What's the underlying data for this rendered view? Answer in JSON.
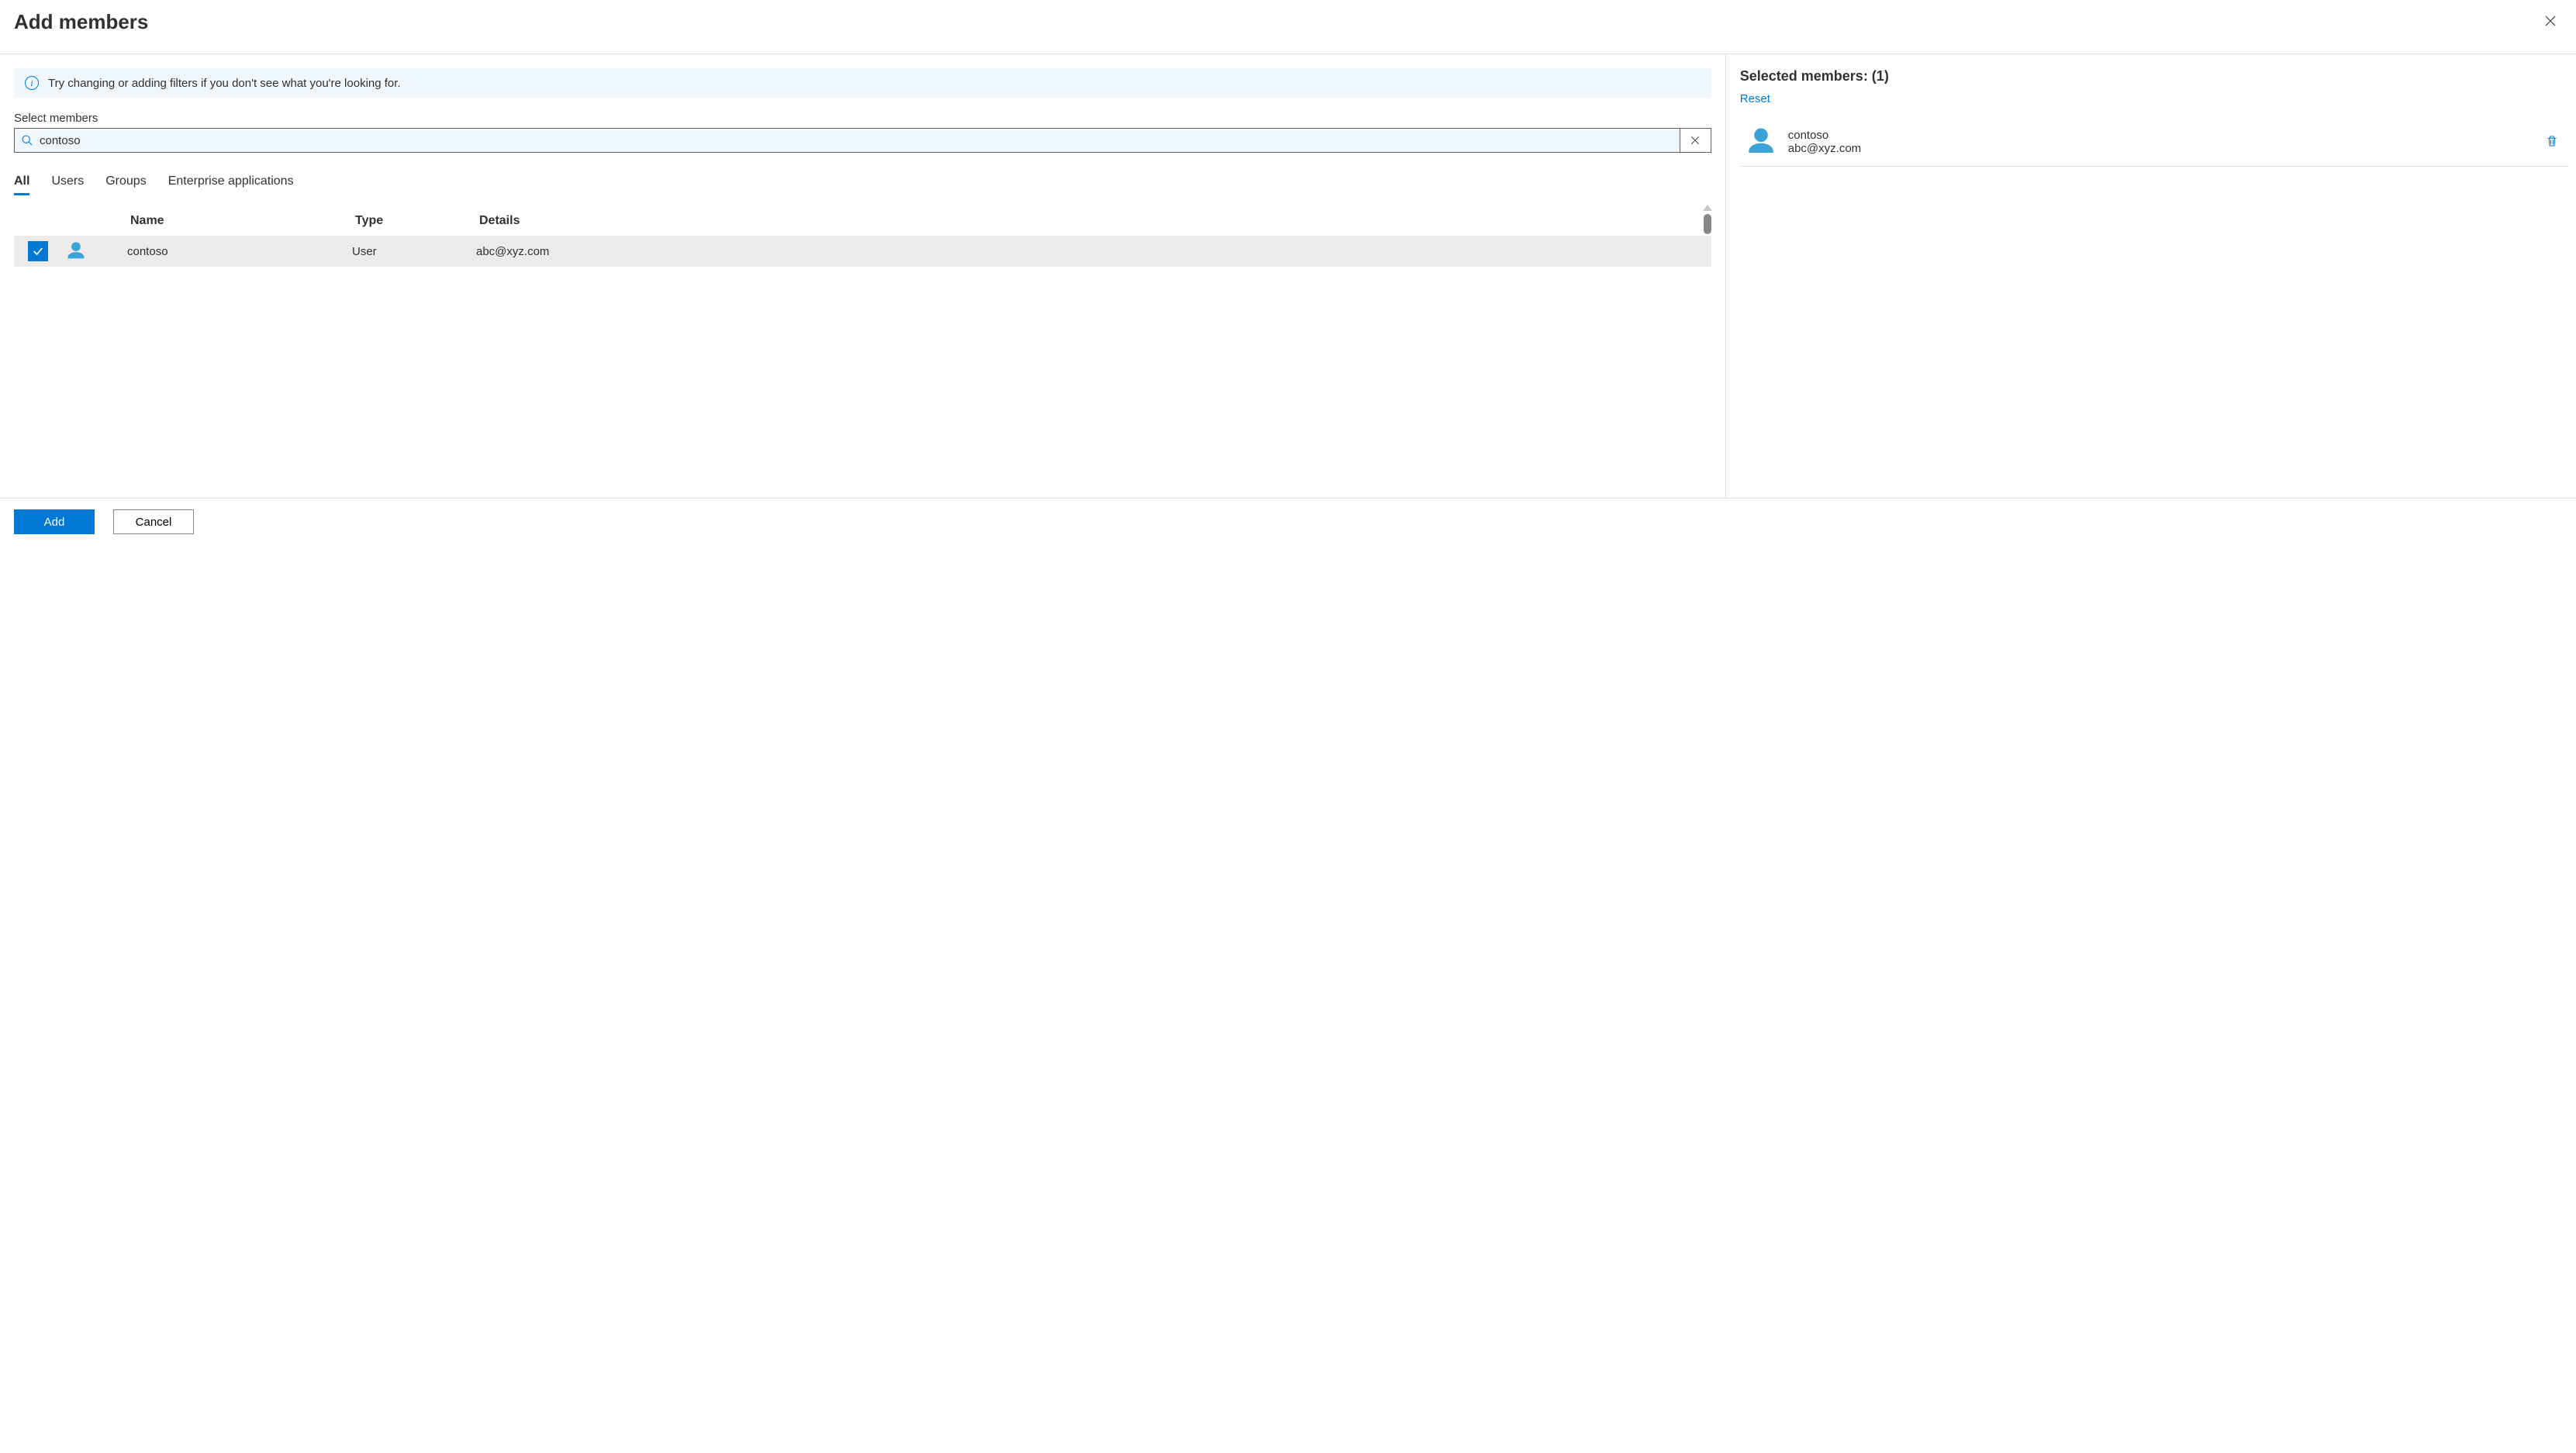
{
  "header": {
    "title": "Add members"
  },
  "info_bar": {
    "message": "Try changing or adding filters if you don't see what you're looking for."
  },
  "search": {
    "label": "Select members",
    "value": "contoso"
  },
  "tabs": {
    "items": [
      {
        "label": "All",
        "active": true
      },
      {
        "label": "Users",
        "active": false
      },
      {
        "label": "Groups",
        "active": false
      },
      {
        "label": "Enterprise applications",
        "active": false
      }
    ]
  },
  "columns": {
    "name": "Name",
    "type": "Type",
    "details": "Details"
  },
  "results": [
    {
      "checked": true,
      "name": "contoso",
      "type": "User",
      "details": "abc@xyz.com"
    }
  ],
  "selected": {
    "title": "Selected members: (1)",
    "reset_label": "Reset",
    "items": [
      {
        "name": "contoso",
        "email": "abc@xyz.com"
      }
    ]
  },
  "footer": {
    "add_label": "Add",
    "cancel_label": "Cancel"
  }
}
